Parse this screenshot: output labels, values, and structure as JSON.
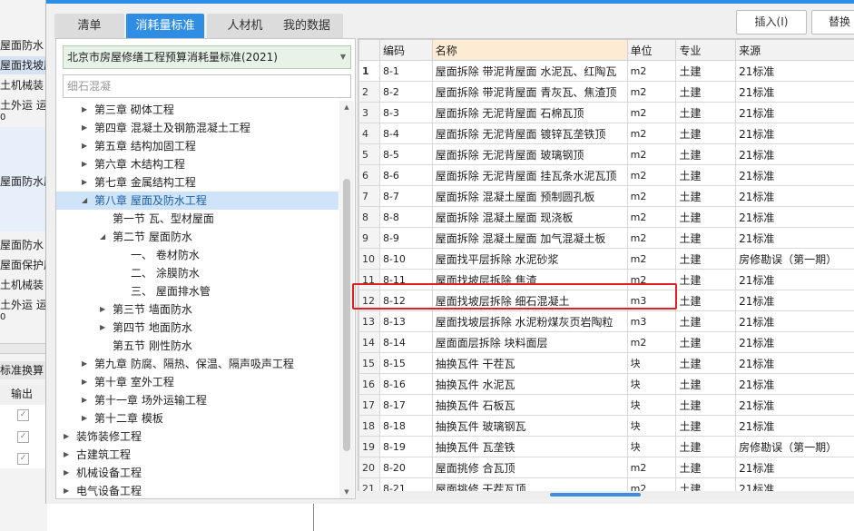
{
  "background_panel": {
    "rows_top": [
      "屋面防水 铺",
      "屋面找坡层",
      "土机械装",
      "土外运 运",
      "0"
    ],
    "rows_mid": [
      "屋面防水层"
    ],
    "rows_bot": [
      "屋面防水 铺",
      "屋面保护层",
      "土机械装",
      "土外运 运",
      "0"
    ],
    "section_title": "标准换算",
    "column_output": "输出",
    "check_mark": "✓"
  },
  "tabs": [
    {
      "label": "清单",
      "active": false
    },
    {
      "label": "消耗量标准",
      "active": true
    },
    {
      "label": "人材机",
      "active": false
    },
    {
      "label": "我的数据",
      "active": false
    }
  ],
  "toolbar": {
    "insert_label": "插入(I)",
    "replace_label": "替换"
  },
  "library_combo": {
    "value": "北京市房屋修缮工程预算消耗量标准(2021)"
  },
  "search": {
    "value": "细石混凝"
  },
  "tree": [
    {
      "label": "第三章 砌体工程",
      "level": 1,
      "state": "collapsed"
    },
    {
      "label": "第四章 混凝土及钢筋混凝土工程",
      "level": 1,
      "state": "collapsed"
    },
    {
      "label": "第五章 结构加固工程",
      "level": 1,
      "state": "collapsed"
    },
    {
      "label": "第六章 木结构工程",
      "level": 1,
      "state": "collapsed"
    },
    {
      "label": "第七章 金属结构工程",
      "level": 1,
      "state": "collapsed"
    },
    {
      "label": "第八章 屋面及防水工程",
      "level": 1,
      "state": "expanded",
      "selected": true
    },
    {
      "label": "第一节 瓦、型材屋面",
      "level": 2,
      "state": "leaf"
    },
    {
      "label": "第二节 屋面防水",
      "level": 2,
      "state": "expanded"
    },
    {
      "label": "一、 卷材防水",
      "level": 3,
      "state": "leaf"
    },
    {
      "label": "二、 涂膜防水",
      "level": 3,
      "state": "leaf"
    },
    {
      "label": "三、 屋面排水管",
      "level": 3,
      "state": "leaf"
    },
    {
      "label": "第三节 墙面防水",
      "level": 2,
      "state": "collapsed"
    },
    {
      "label": "第四节 地面防水",
      "level": 2,
      "state": "collapsed"
    },
    {
      "label": "第五节 刚性防水",
      "level": 2,
      "state": "leaf"
    },
    {
      "label": "第九章 防腐、隔热、保温、隔声吸声工程",
      "level": 1,
      "state": "collapsed"
    },
    {
      "label": "第十章 室外工程",
      "level": 1,
      "state": "collapsed"
    },
    {
      "label": "第十一章 场外运输工程",
      "level": 1,
      "state": "collapsed"
    },
    {
      "label": "第十二章 模板",
      "level": 1,
      "state": "collapsed"
    },
    {
      "label": "装饰装修工程",
      "level": 0,
      "state": "collapsed"
    },
    {
      "label": "古建筑工程",
      "level": 0,
      "state": "collapsed"
    },
    {
      "label": "机械设备工程",
      "level": 0,
      "state": "collapsed"
    },
    {
      "label": "电气设备工程",
      "level": 0,
      "state": "collapsed"
    }
  ],
  "grid": {
    "columns": [
      "",
      "编码",
      "名称",
      "单位",
      "专业",
      "来源"
    ],
    "rows": [
      [
        "1",
        "8-1",
        "屋面拆除 带泥背屋面 水泥瓦、红陶瓦",
        "m2",
        "土建",
        "21标准"
      ],
      [
        "2",
        "8-2",
        "屋面拆除 带泥背屋面 青灰瓦、焦渣顶",
        "m2",
        "土建",
        "21标准"
      ],
      [
        "3",
        "8-3",
        "屋面拆除 无泥背屋面 石棉瓦顶",
        "m2",
        "土建",
        "21标准"
      ],
      [
        "4",
        "8-4",
        "屋面拆除 无泥背屋面 镀锌瓦垄铁顶",
        "m2",
        "土建",
        "21标准"
      ],
      [
        "5",
        "8-5",
        "屋面拆除 无泥背屋面 玻璃钢顶",
        "m2",
        "土建",
        "21标准"
      ],
      [
        "6",
        "8-6",
        "屋面拆除 无泥背屋面 挂瓦条水泥瓦顶",
        "m2",
        "土建",
        "21标准"
      ],
      [
        "7",
        "8-7",
        "屋面拆除 混凝土屋面 预制圆孔板",
        "m2",
        "土建",
        "21标准"
      ],
      [
        "8",
        "8-8",
        "屋面拆除 混凝土屋面 现浇板",
        "m2",
        "土建",
        "21标准"
      ],
      [
        "9",
        "8-9",
        "屋面拆除 混凝土屋面 加气混凝土板",
        "m2",
        "土建",
        "21标准"
      ],
      [
        "10",
        "8-10",
        "屋面找平层拆除 水泥砂浆",
        "m2",
        "土建",
        "房修勘误（第一期）"
      ],
      [
        "11",
        "8-11",
        "屋面找坡层拆除 焦渣",
        "m2",
        "土建",
        "21标准"
      ],
      [
        "12",
        "8-12",
        "屋面找坡层拆除 细石混凝土",
        "m3",
        "土建",
        "21标准"
      ],
      [
        "13",
        "8-13",
        "屋面找坡层拆除 水泥粉煤灰页岩陶粒",
        "m3",
        "土建",
        "21标准"
      ],
      [
        "14",
        "8-14",
        "屋面面层拆除 块料面层",
        "m2",
        "土建",
        "21标准"
      ],
      [
        "15",
        "8-15",
        "抽换瓦件 干茬瓦",
        "块",
        "土建",
        "21标准"
      ],
      [
        "16",
        "8-16",
        "抽换瓦件 水泥瓦",
        "块",
        "土建",
        "21标准"
      ],
      [
        "17",
        "8-17",
        "抽换瓦件 石板瓦",
        "块",
        "土建",
        "21标准"
      ],
      [
        "18",
        "8-18",
        "抽换瓦件 玻璃钢瓦",
        "块",
        "土建",
        "21标准"
      ],
      [
        "19",
        "8-19",
        "抽换瓦件 瓦垄铁",
        "块",
        "土建",
        "房修勘误（第一期）"
      ],
      [
        "20",
        "8-20",
        "屋面挑修 合瓦顶",
        "m2",
        "土建",
        "21标准"
      ],
      [
        "21",
        "8-21",
        "屋面挑修 干茬瓦顶",
        "m2",
        "土建",
        "21标准"
      ]
    ],
    "highlighted_row": 12
  },
  "colors": {
    "accent": "#2f8ee4",
    "highlight_border": "#e02020",
    "selected_node": "#cfe4f8",
    "library_combo_bg": "#e7f3e7"
  }
}
